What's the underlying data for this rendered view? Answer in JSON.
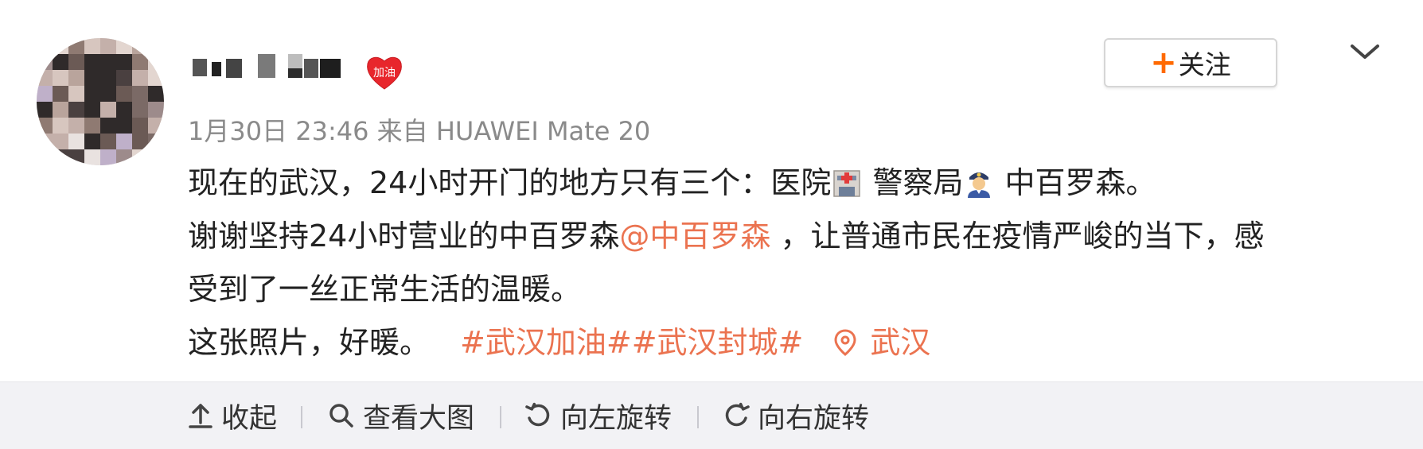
{
  "author": {
    "name_redacted": true
  },
  "badge": {
    "label": "加油",
    "color": "#e8262c"
  },
  "follow_button": {
    "plus": "+",
    "label": "关注"
  },
  "meta": {
    "date": "1月30日 23:46",
    "from_prefix": "来自",
    "device": "HUAWEI Mate 20"
  },
  "post": {
    "line1": {
      "text": "现在的武汉，24小时开门的地方只有三个：医院",
      "after_hospital": " 警察局",
      "after_police": " 中百罗森。"
    },
    "line2": {
      "before": "谢谢坚持24小时营业的中百罗森",
      "mention": "@中百罗森",
      "after": " ，让普通市民在疫情严峻的当下，感"
    },
    "line3": {
      "text": "受到了一丝正常生活的温暖。"
    },
    "line4": {
      "text": "这张照片，好暖。",
      "topics": "#武汉加油##武汉封城#",
      "location": "武汉"
    },
    "emojis": [
      "hospital-emoji",
      "police-officer-emoji"
    ],
    "link_color": "#eb7350"
  },
  "toolbar": {
    "items": [
      {
        "icon": "collapse-up-icon",
        "label": "收起"
      },
      {
        "icon": "magnifier-icon",
        "label": "查看大图"
      },
      {
        "icon": "rotate-left-icon",
        "label": "向左旋转"
      },
      {
        "icon": "rotate-right-icon",
        "label": "向右旋转"
      }
    ]
  }
}
